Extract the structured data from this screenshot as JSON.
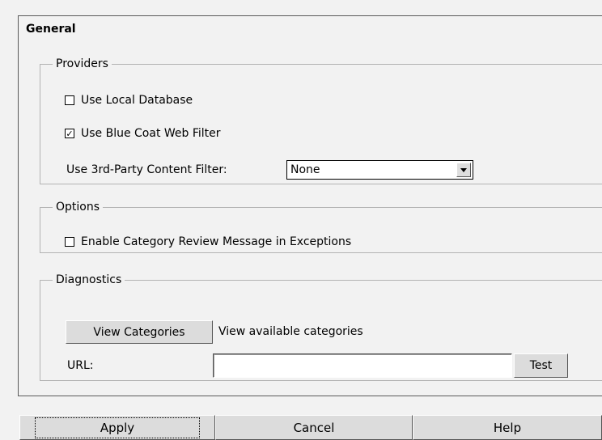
{
  "panel": {
    "title": "General"
  },
  "providers": {
    "legend": "Providers",
    "use_local_database": {
      "label": "Use Local Database",
      "checked": false
    },
    "use_blue_coat": {
      "label": "Use Blue Coat Web Filter",
      "checked": true
    },
    "third_party_label": "Use 3rd-Party Content Filter:",
    "third_party_value": "None"
  },
  "options": {
    "legend": "Options",
    "enable_review": {
      "label": "Enable Category Review Message in Exceptions",
      "checked": false
    }
  },
  "diagnostics": {
    "legend": "Diagnostics",
    "view_categories_button": "View Categories",
    "view_categories_desc": "View available categories",
    "url_label": "URL:",
    "url_value": "",
    "test_button": "Test"
  },
  "footer": {
    "apply": "Apply",
    "cancel": "Cancel",
    "help": "Help"
  }
}
